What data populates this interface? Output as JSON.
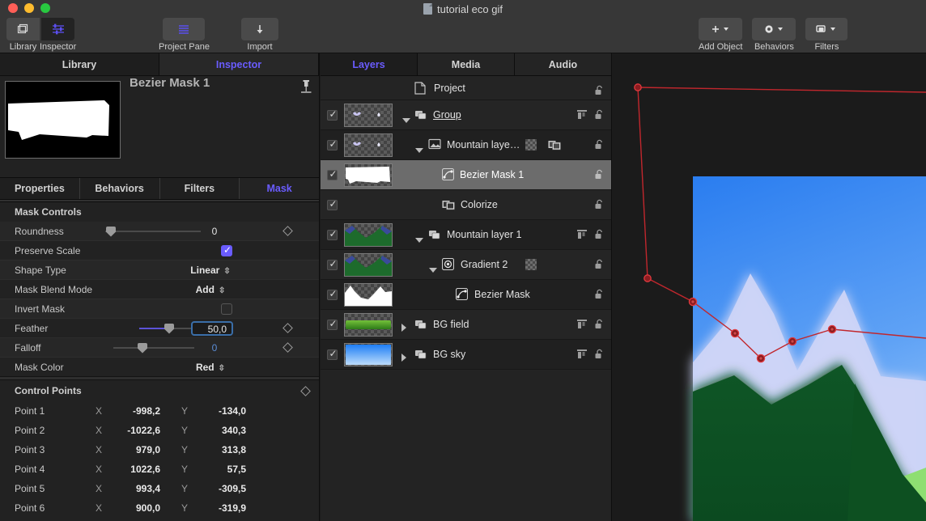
{
  "window": {
    "document_title": "tutorial eco gif",
    "traffic_lights": [
      "close-red",
      "minimize-yellow",
      "zoom-green"
    ]
  },
  "toolbar": {
    "left_group": [
      {
        "label": "Library",
        "icon": "layers-stack-icon",
        "active": false
      },
      {
        "label": "Inspector",
        "icon": "sliders-icon",
        "active": true
      }
    ],
    "center_group": [
      {
        "label": "Project Pane",
        "icon": "list-lines-icon"
      }
    ],
    "right_group": [
      {
        "label": "Import",
        "icon": "arrow-down-icon"
      }
    ],
    "far_right_group": [
      {
        "label": "Add Object",
        "icon": "plus-icon"
      },
      {
        "label": "Behaviors",
        "icon": "gear-icon"
      },
      {
        "label": "Filters",
        "icon": "filters-icon"
      }
    ]
  },
  "left_pane": {
    "tabs": [
      {
        "label": "Library",
        "active": false
      },
      {
        "label": "Inspector",
        "active": true
      }
    ],
    "selected_object_name": "Bezier Mask 1",
    "pin_icon": "pin-icon",
    "sub_tabs": [
      {
        "label": "Properties",
        "active": false
      },
      {
        "label": "Behaviors",
        "active": false
      },
      {
        "label": "Filters",
        "active": false
      },
      {
        "label": "Mask",
        "active": true
      }
    ],
    "mask_controls": {
      "section_label": "Mask Controls",
      "rows": [
        {
          "label": "Roundness",
          "type": "slider",
          "value": "0",
          "slider_pct": 3,
          "keyframe": true,
          "value_color": "normal"
        },
        {
          "label": "Preserve Scale",
          "type": "checkbox",
          "checked": true
        },
        {
          "label": "Shape Type",
          "type": "popup",
          "value": "Linear"
        },
        {
          "label": "Mask Blend Mode",
          "type": "popup",
          "value": "Add"
        },
        {
          "label": "Invert Mask",
          "type": "checkbox",
          "checked": false
        },
        {
          "label": "Feather",
          "type": "slider-field",
          "value": "50,0",
          "slider_pct": 55,
          "keyframe": true
        },
        {
          "label": "Falloff",
          "type": "slider",
          "value": "0",
          "slider_pct": 42,
          "keyframe": true,
          "value_color": "blue"
        },
        {
          "label": "Mask Color",
          "type": "popup",
          "value": "Red"
        }
      ]
    },
    "control_points": {
      "section_label": "Control Points",
      "keyframe": true,
      "x_axis_label": "X",
      "y_axis_label": "Y",
      "points": [
        {
          "name": "Point 1",
          "x": "-998,2",
          "y": "-134,0"
        },
        {
          "name": "Point 2",
          "x": "-1022,6",
          "y": "340,3"
        },
        {
          "name": "Point 3",
          "x": "979,0",
          "y": "313,8"
        },
        {
          "name": "Point 4",
          "x": "1022,6",
          "y": "57,5"
        },
        {
          "name": "Point 5",
          "x": "993,4",
          "y": "-309,5"
        },
        {
          "name": "Point 6",
          "x": "900,0",
          "y": "-319,9"
        }
      ]
    }
  },
  "layers_pane": {
    "tabs": [
      {
        "label": "Layers",
        "active": true
      },
      {
        "label": "Media",
        "active": false
      },
      {
        "label": "Audio",
        "active": false
      }
    ],
    "rows": [
      {
        "name": "Project",
        "indent": 0,
        "has_checkbox": false,
        "has_thumb": false,
        "icon": "document-icon",
        "disclosure": "none",
        "selected": false,
        "lock": true,
        "underline": false
      },
      {
        "name": "Group",
        "indent": 1,
        "has_checkbox": true,
        "has_thumb": true,
        "icon": "group-icon",
        "disclosure": "open",
        "selected": false,
        "lock": true,
        "align": true,
        "underline": true,
        "thumb": "birds"
      },
      {
        "name": "Mountain laye…",
        "indent": 2,
        "has_checkbox": true,
        "has_thumb": true,
        "icon": "image-icon",
        "disclosure": "open",
        "selected": false,
        "lock": true,
        "mask_badge": true,
        "filter_badge": true,
        "thumb": "birds"
      },
      {
        "name": "Bezier Mask 1",
        "indent": 3,
        "has_checkbox": true,
        "has_thumb": true,
        "icon": "bezier-icon",
        "disclosure": "none",
        "selected": true,
        "lock": true,
        "thumb": "mask-white"
      },
      {
        "name": "Colorize",
        "indent": 3,
        "has_checkbox": true,
        "has_thumb": false,
        "icon": "filter-icon",
        "disclosure": "none",
        "selected": false,
        "lock": true
      },
      {
        "name": "Mountain layer 1",
        "indent": 2,
        "has_checkbox": true,
        "has_thumb": true,
        "icon": "group-icon",
        "disclosure": "open",
        "selected": false,
        "lock": true,
        "align": true,
        "thumb": "mountain-green"
      },
      {
        "name": "Gradient 2",
        "indent": 3,
        "has_checkbox": true,
        "has_thumb": true,
        "icon": "gradient-icon",
        "disclosure": "open",
        "selected": false,
        "lock": true,
        "mask_badge": true,
        "thumb": "mountain-green"
      },
      {
        "name": "Bezier Mask",
        "indent": 4,
        "has_checkbox": true,
        "has_thumb": true,
        "icon": "bezier-icon",
        "disclosure": "none",
        "selected": false,
        "lock": true,
        "thumb": "mask-peaks"
      },
      {
        "name": "BG field",
        "indent": 2,
        "has_checkbox": true,
        "has_thumb": true,
        "icon": "group-icon",
        "disclosure": "closed",
        "selected": false,
        "lock": true,
        "align": true,
        "thumb": "green-bar"
      },
      {
        "name": "BG sky",
        "indent": 2,
        "has_checkbox": true,
        "has_thumb": true,
        "icon": "group-icon",
        "disclosure": "closed",
        "selected": false,
        "lock": true,
        "align": true,
        "thumb": "blue-grad"
      }
    ]
  },
  "canvas": {
    "description": "mountain-scene-preview",
    "bezier_overlay_color": "#c1272d",
    "point_fill_color": "#7a1518",
    "sky_color": "#2a7df0",
    "snow_color": "#ccd4f7",
    "field_color": "#0f5626",
    "grass_color": "#8ede72"
  },
  "colors": {
    "accent_purple": "#6a5cff",
    "window_chrome": "#373737",
    "panel_bg": "#222222",
    "selection_gray": "#6c6c6c",
    "field_focus_blue": "#3a6ea8"
  }
}
